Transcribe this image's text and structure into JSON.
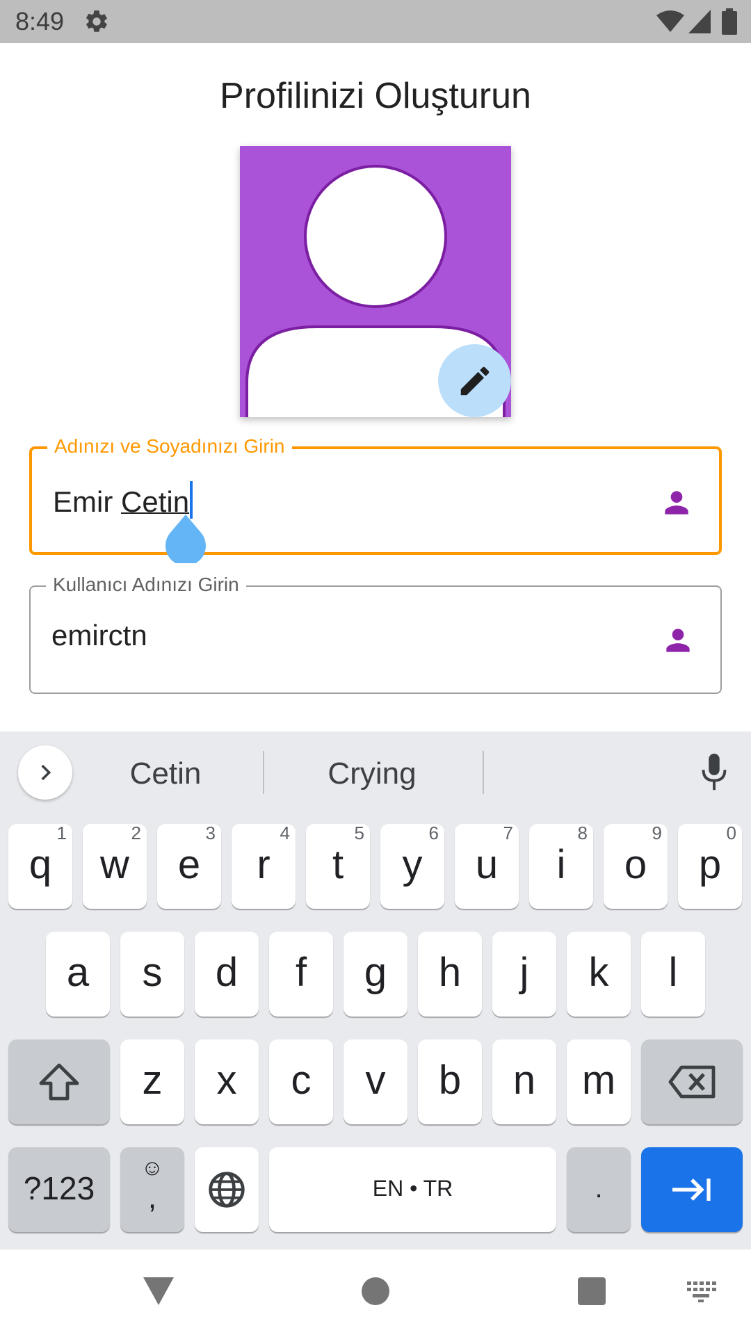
{
  "status_bar": {
    "time": "8:49"
  },
  "title": "Profilinizi Oluşturun",
  "avatar": {
    "background_color": "#ab53d8",
    "edit_icon": "pencil-icon"
  },
  "fields": {
    "full_name": {
      "label": "Adınızı ve Soyadınızı Girin",
      "value_first": "Emir ",
      "value_composing": "Cetin"
    },
    "username": {
      "label": "Kullanıcı Adınızı Girin",
      "value": "emirctn"
    }
  },
  "keyboard": {
    "suggestions": [
      "Cetin",
      "Crying"
    ],
    "row1": [
      {
        "key": "q",
        "hint": "1"
      },
      {
        "key": "w",
        "hint": "2"
      },
      {
        "key": "e",
        "hint": "3"
      },
      {
        "key": "r",
        "hint": "4"
      },
      {
        "key": "t",
        "hint": "5"
      },
      {
        "key": "y",
        "hint": "6"
      },
      {
        "key": "u",
        "hint": "7"
      },
      {
        "key": "i",
        "hint": "8"
      },
      {
        "key": "o",
        "hint": "9"
      },
      {
        "key": "p",
        "hint": "0"
      }
    ],
    "row2": [
      "a",
      "s",
      "d",
      "f",
      "g",
      "h",
      "j",
      "k",
      "l"
    ],
    "row3": [
      "z",
      "x",
      "c",
      "v",
      "b",
      "n",
      "m"
    ],
    "symbols_label": "?123",
    "emoji_label": "☺",
    "comma_label": ",",
    "space_label": "EN • TR",
    "period_label": "."
  },
  "colors": {
    "accent_orange": "#ff9800",
    "icon_purple": "#8e24aa",
    "enter_blue": "#1a73e8"
  }
}
